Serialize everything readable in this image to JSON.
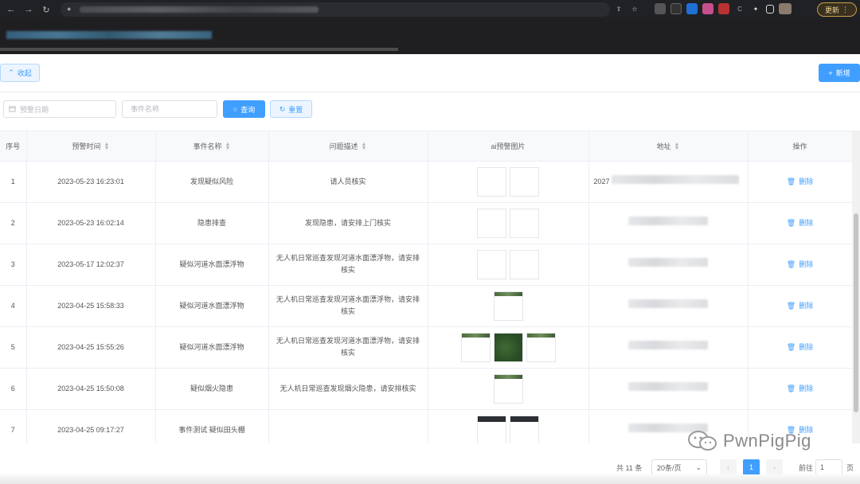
{
  "browser": {
    "update_label": "更新",
    "extension_icons": [
      "share-icon",
      "star-icon",
      "extension-a-icon",
      "extension-b-icon",
      "extension-c-icon",
      "extension-d-icon",
      "extension-e-icon",
      "extension-f-icon",
      "puzzle-icon",
      "sidebar-icon",
      "avatar"
    ]
  },
  "toolbar": {
    "collapse_label": "收起",
    "add_label": "新增"
  },
  "filters": {
    "date_placeholder": "预警日期",
    "name_placeholder": "事件名称",
    "query_label": "查询",
    "reset_label": "重置"
  },
  "table": {
    "columns": [
      "序号",
      "预警时间",
      "事件名称",
      "问题描述",
      "ai预警图片",
      "地址",
      "操作"
    ],
    "delete_label": "删除",
    "rows": [
      {
        "index": "1",
        "time": "2023-05-23 16:23:01",
        "name": "发现疑似风险",
        "desc": "请人员核实",
        "address_prefix": "2027"
      },
      {
        "index": "2",
        "time": "2023-05-23 16:02:14",
        "name": "隐患排查",
        "desc": "发现隐患，请安排上门核实",
        "address_prefix": ""
      },
      {
        "index": "3",
        "time": "2023-05-17 12:02:37",
        "name": "疑似河道水面漂浮物",
        "desc": "无人机日常巡查发现河道水面漂浮物，请安排核实",
        "address_prefix": ""
      },
      {
        "index": "4",
        "time": "2023-04-25 15:58:33",
        "name": "疑似河道水面漂浮物",
        "desc": "无人机日常巡查发现河道水面漂浮物，请安排核实",
        "address_prefix": ""
      },
      {
        "index": "5",
        "time": "2023-04-25 15:55:26",
        "name": "疑似河道水面漂浮物",
        "desc": "无人机日常巡查发现河道水面漂浮物，请安排核实",
        "address_prefix": ""
      },
      {
        "index": "6",
        "time": "2023-04-25 15:50:08",
        "name": "疑似烟火隐患",
        "desc": "无人机日常巡查发现烟火隐患，请安排核实",
        "address_prefix": ""
      },
      {
        "index": "7",
        "time": "2023-04-25 09:17:27",
        "name": "事件测试 疑似田头棚",
        "desc": "",
        "address_prefix": ""
      }
    ]
  },
  "pagination": {
    "total_text": "共 11 条",
    "page_size": "20条/页",
    "current_page": "1",
    "goto_label": "前往",
    "goto_value": "1",
    "goto_suffix": "页"
  },
  "watermark": {
    "text": "PwnPigPig"
  },
  "colors": {
    "primary": "#409eff",
    "primary_light": "#ecf5ff",
    "border": "#ebeef5",
    "chrome_dark": "#202124"
  }
}
